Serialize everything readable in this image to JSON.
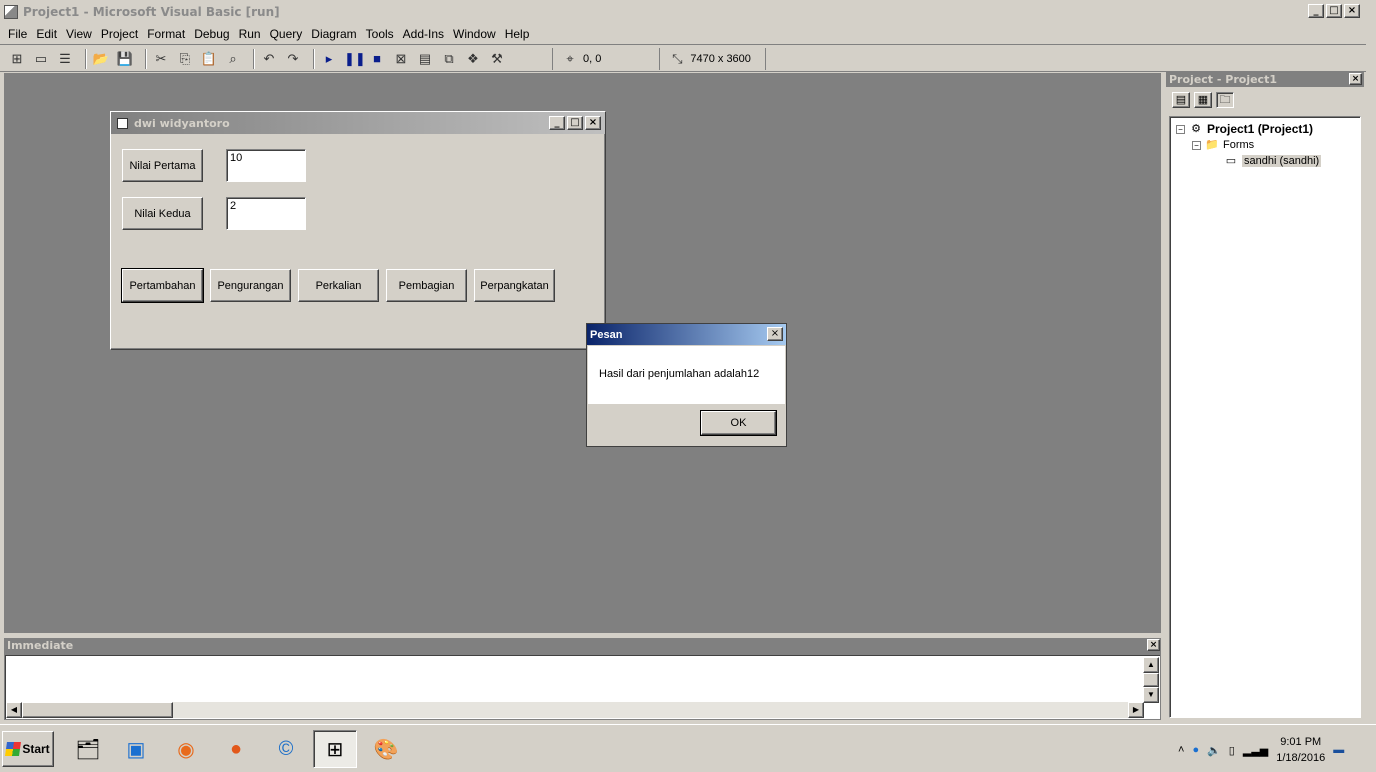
{
  "window": {
    "title": "Project1 - Microsoft Visual Basic [run]"
  },
  "menu": [
    "File",
    "Edit",
    "View",
    "Project",
    "Format",
    "Debug",
    "Run",
    "Query",
    "Diagram",
    "Tools",
    "Add-Ins",
    "Window",
    "Help"
  ],
  "toolbar": {
    "position": "0, 0",
    "size": "7470 x 3600"
  },
  "form": {
    "title": "dwi widyantoro",
    "label1": "Nilai Pertama",
    "value1": "10",
    "label2": "Nilai Kedua",
    "value2": "2",
    "buttons": [
      "Pertambahan",
      "Pengurangan",
      "Perkalian",
      "Pembagian",
      "Perpangkatan"
    ]
  },
  "msgbox": {
    "title": "Pesan",
    "message": "Hasil dari penjumlahan adalah12",
    "ok": "OK"
  },
  "project": {
    "title": "Project - Project1",
    "root": "Project1 (Project1)",
    "folder": "Forms",
    "item": "sandhi (sandhi)"
  },
  "immediate": {
    "title": "Immediate"
  },
  "taskbar": {
    "start": "Start",
    "time": "9:01 PM",
    "date": "1/18/2016"
  }
}
